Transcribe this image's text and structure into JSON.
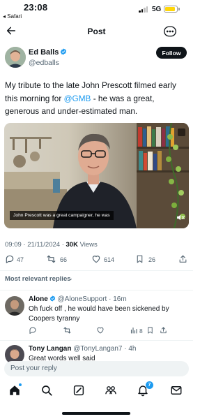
{
  "status_bar": {
    "time": "23:08",
    "back_label": "◂ Safari",
    "network": "5G",
    "battery_level": 0.85,
    "signal_bars_active": 2,
    "battery_color": "#ffd60a"
  },
  "header": {
    "title": "Post",
    "back_icon": "arrow-left-icon",
    "more_icon": "more-horizontal-icon"
  },
  "post": {
    "author_name": "Ed Balls",
    "author_handle": "@edballs",
    "verified": true,
    "follow_label": "Follow",
    "text_before": "My tribute to the late John Prescott filmed early this morning for ",
    "mention": "@GMB",
    "text_after": " - he was a great, generous and under-estimated man.",
    "video_caption": "John Prescott was a great campaigner, he was",
    "timestamp": "09:09 · 21/11/2024 · ",
    "views_count": "30K",
    "views_label": " Views",
    "actions": {
      "replies": "47",
      "reposts": "66",
      "likes": "614",
      "bookmarks": "26"
    }
  },
  "replies_section": {
    "label": "Most relevant replies",
    "chevron": "⌄"
  },
  "replies": [
    {
      "name": "Alone",
      "handle": "@AloneSupport",
      "time": " · 16m",
      "verified": true,
      "text": "Oh fuck off , he would have been sickened by Coopers tyranny",
      "views": "8"
    },
    {
      "name": "Tony Langan",
      "handle": "@TonyLangan7",
      "time": " · 4h",
      "verified": false,
      "text": "Great words well said"
    }
  ],
  "composer": {
    "placeholder": "Post your reply"
  },
  "bottom_nav": {
    "notifications_badge": "7",
    "tabs": [
      "home-icon",
      "search-icon",
      "grok-icon",
      "communities-icon",
      "notifications-icon",
      "messages-icon"
    ]
  },
  "colors": {
    "accent": "#1d9bf0",
    "text": "#0f1419",
    "muted": "#536471"
  }
}
